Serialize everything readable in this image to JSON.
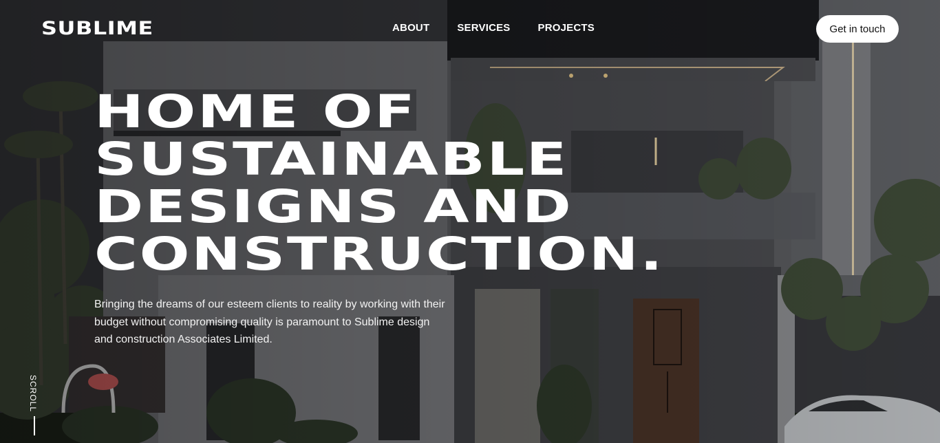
{
  "brand": {
    "name": "SUBLIME"
  },
  "nav": {
    "items": [
      {
        "label": "ABOUT"
      },
      {
        "label": "SERVICES"
      },
      {
        "label": "PROJECTS"
      }
    ]
  },
  "cta": {
    "label": "Get in touch"
  },
  "hero": {
    "headline_lines": [
      "HOME OF",
      "SUSTAINABLE",
      "DESIGNS AND",
      "CONSTRUCTION."
    ],
    "description": "Bringing the dreams of our esteem clients to reality by working with their budget without compromising quality is paramount to Sublime design and construction Associates Limited.",
    "scroll_label": "SCROLL"
  }
}
